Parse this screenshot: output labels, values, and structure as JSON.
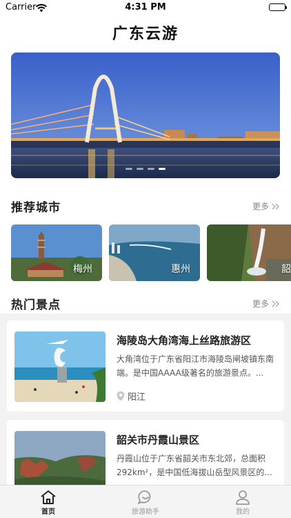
{
  "status_bar": {
    "carrier": "Carrier",
    "time": "4:31 PM"
  },
  "header": {
    "title": "广东云游"
  },
  "sections": {
    "cities": {
      "title": "推荐城市",
      "more": "更多"
    },
    "spots": {
      "title": "热门景点",
      "more": "更多"
    }
  },
  "cities": [
    {
      "name": "梅州"
    },
    {
      "name": "惠州"
    },
    {
      "name": "韶"
    }
  ],
  "spots": [
    {
      "title": "海陵岛大角湾海上丝路旅游区",
      "desc": "大角湾位于广东省阳江市海陵岛闸坡镇东南端。是中国AAAA级著名的旅游景点。...",
      "location": "阳江"
    },
    {
      "title": "韶关市丹霞山景区",
      "desc": "丹霞山位于广东省韶关市东北郊，总面积292km²，是中国低海拔山岳型风景区的...",
      "location": ""
    }
  ],
  "tabs": [
    {
      "label": "首页",
      "icon": "home-icon"
    },
    {
      "label": "旅游助手",
      "icon": "chat-icon"
    },
    {
      "label": "我的",
      "icon": "user-icon"
    }
  ],
  "colors": {
    "accent": "#222222",
    "inactive": "#999999"
  }
}
